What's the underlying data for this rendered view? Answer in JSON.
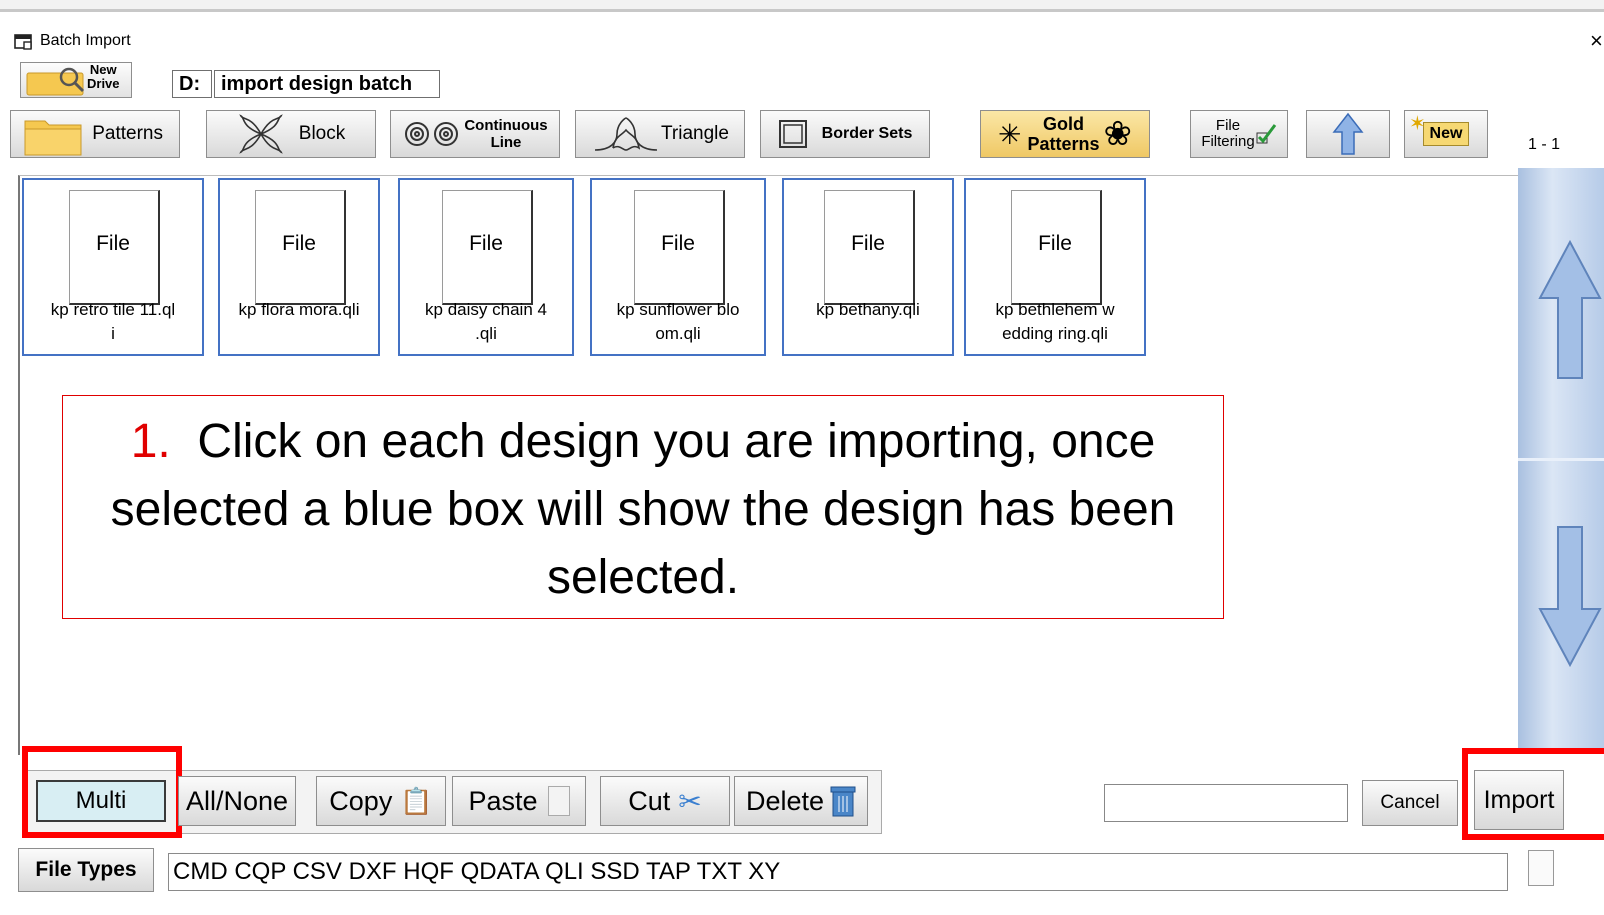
{
  "window": {
    "title": "Batch Import",
    "close": "×"
  },
  "drive": {
    "new_drive_line1": "New",
    "new_drive_line2": "Drive",
    "drive_letter": "D:",
    "folder": "import design batch"
  },
  "toolbar": {
    "patterns": "Patterns",
    "block": "Block",
    "continuous_1": "Continuous",
    "continuous_2": "Line",
    "triangle": "Triangle",
    "border_sets": "Border Sets",
    "gold_1": "Gold",
    "gold_2": "Patterns",
    "file_filtering_1": "File",
    "file_filtering_2": "Filtering",
    "new": "New",
    "page_indicator": "1 - 1"
  },
  "files": [
    {
      "type": "File",
      "name_1": "kp retro tile 11.ql",
      "name_2": "i"
    },
    {
      "type": "File",
      "name_1": "kp flora mora.qli",
      "name_2": ""
    },
    {
      "type": "File",
      "name_1": "kp daisy chain 4",
      "name_2": ".qli"
    },
    {
      "type": "File",
      "name_1": "kp sunflower blo",
      "name_2": "om.qli"
    },
    {
      "type": "File",
      "name_1": "kp bethany.qli",
      "name_2": ""
    },
    {
      "type": "File",
      "name_1": "kp bethlehem w",
      "name_2": "edding ring.qli"
    }
  ],
  "annotation": {
    "number": "1.",
    "text_1": "Click on each design you are importing, once",
    "text_2": "selected a blue box will show the design has been",
    "text_3": "selected."
  },
  "bottom": {
    "multi": "Multi",
    "all_none": "All/None",
    "copy": "Copy",
    "paste": "Paste",
    "cut": "Cut",
    "delete": "Delete",
    "search_value": "",
    "cancel": "Cancel",
    "import": "Import"
  },
  "file_types": {
    "label": "File Types",
    "list": "CMD  CQP  CSV  DXF  HQF  QDATA  QLI  SSD  TAP  TXT  XY"
  },
  "colors": {
    "selection_blue": "#4472c4",
    "annotation_red": "#e00000",
    "highlight_red": "#ff0000",
    "gold": "#f3d47a"
  }
}
